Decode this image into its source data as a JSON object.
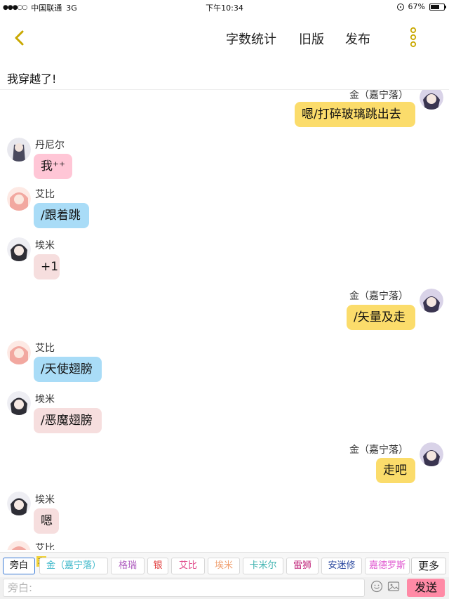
{
  "status_bar": {
    "carrier": "中国联通",
    "network": "3G",
    "time": "下午10:34",
    "battery": "67%",
    "battery_level": 0.67
  },
  "nav": {
    "back_icon": "chevron-left-icon",
    "word_count": "字数统计",
    "old_version": "旧版",
    "publish": "发布",
    "more_icon": "vertical-dots-icon",
    "accent": "#c9a800"
  },
  "story_title": "我穿越了!",
  "messages": [
    {
      "side": "right",
      "sender": "金（嘉宁落）",
      "text": "嗯/打碎玻璃跳出去",
      "color": "#fbdc6b"
    },
    {
      "side": "left",
      "sender": "丹尼尔",
      "text": "我⁺⁺",
      "color": "#ffc6d6"
    },
    {
      "side": "left",
      "sender": "艾比",
      "text": "/跟着跳",
      "color": "#a9dcf7"
    },
    {
      "side": "left",
      "sender": "埃米",
      "text": "+1",
      "color": "#f6dede"
    },
    {
      "side": "right",
      "sender": "金（嘉宁落）",
      "text": "/矢量及走",
      "color": "#fbdc6b"
    },
    {
      "side": "left",
      "sender": "艾比",
      "text": "/天使翅膀",
      "color": "#a9dcf7"
    },
    {
      "side": "left",
      "sender": "埃米",
      "text": "/恶魔翅膀",
      "color": "#f6dede"
    },
    {
      "side": "right",
      "sender": "金（嘉宁落）",
      "text": "走吧",
      "color": "#fbdc6b"
    },
    {
      "side": "left",
      "sender": "埃米",
      "text": "嗯",
      "color": "#f6dede"
    },
    {
      "side": "left",
      "sender": "艾比",
      "text": "",
      "color": "#a9dcf7"
    }
  ],
  "roles": [
    {
      "label": "旁白",
      "color": "#111111",
      "active": true
    },
    {
      "label": "金（嘉宁落）",
      "color": "#3bb7c9",
      "master": "主"
    },
    {
      "label": "格瑞",
      "color": "#b05fc0"
    },
    {
      "label": "银",
      "color": "#e03a3a"
    },
    {
      "label": "艾比",
      "color": "#e04a8a"
    },
    {
      "label": "埃米",
      "color": "#f0a070"
    },
    {
      "label": "卡米尔",
      "color": "#3fb3b0"
    },
    {
      "label": "雷狮",
      "color": "#c0257a"
    },
    {
      "label": "安迷修",
      "color": "#2d4aa0"
    },
    {
      "label": "嘉德罗斯",
      "color": "#e05ad0"
    }
  ],
  "more_roles": "更多",
  "input": {
    "placeholder": "旁白:",
    "value": "",
    "emoji_icon": "smiley-icon",
    "image_icon": "image-icon",
    "send": "发送",
    "send_color": "#ff8aa6"
  }
}
